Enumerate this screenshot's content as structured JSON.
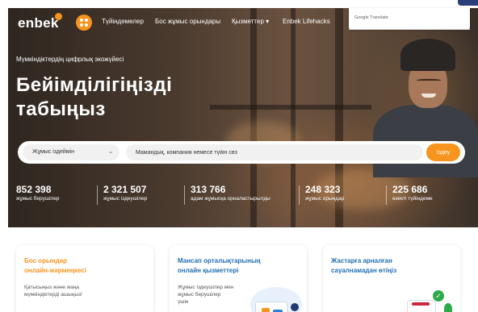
{
  "header": {
    "logo": "enbek",
    "nav": [
      "Түйіндемелер",
      "Бос жұмыс орындары",
      "Қызметтер ▾",
      "Enbek Lifehacks"
    ]
  },
  "translate_widget": {
    "label": "Google Translate"
  },
  "hero": {
    "tagline": "Мүмкіндіктердің цифрлық экожүйесі",
    "headline_line1": "Бейімділігіңізді",
    "headline_line2": "табыңыз"
  },
  "search": {
    "select_value": "Жұмыс іздеймін",
    "input_placeholder": "Мамандық, компания немесе түйін сөз",
    "button_label": "Іздеу"
  },
  "stats": [
    {
      "value": "852 398",
      "label": "жұмыс берушілер"
    },
    {
      "value": "2 321 507",
      "label": "жұмыс іздеушілер"
    },
    {
      "value": "313 766",
      "label": "адам жұмысқа орналастырылды"
    },
    {
      "value": "248 323",
      "label": "жұмыс орындар"
    },
    {
      "value": "225 686",
      "label": "өзекті түйіндеме"
    }
  ],
  "cards": [
    {
      "title_line1": "Бос орындар",
      "title_line2": "онлайн-жәрмеңкесі",
      "desc_line1": "Қатысыңыз және жаңа",
      "desc_line2": "мүмкіндіктерді ашыңыз!",
      "desc_line3": ""
    },
    {
      "title_line1": "Мансап орталықтарының",
      "title_line2": "онлайн қызметтері",
      "desc_line1": "Жұмыс іздеушілер мен",
      "desc_line2": "жұмыс берушілер",
      "desc_line3": "үшін"
    },
    {
      "title_line1": "Жастарға арналған",
      "title_line2": "сауалнамадан өтіңіз",
      "desc_line1": "",
      "desc_line2": "",
      "desc_line3": ""
    }
  ],
  "colors": {
    "accent": "#f7941d",
    "title_blue": "#1f6fb2"
  }
}
